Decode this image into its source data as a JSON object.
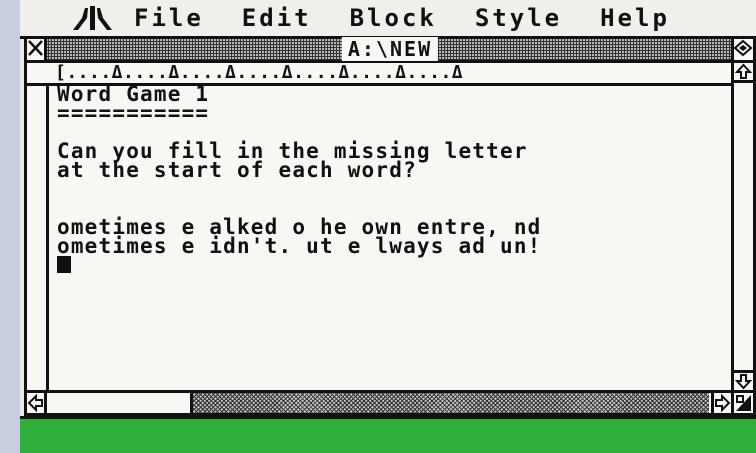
{
  "menubar": {
    "logo_icon": "atari-fuji-icon",
    "items": [
      {
        "label": "File"
      },
      {
        "label": "Edit"
      },
      {
        "label": "Block"
      },
      {
        "label": "Style"
      },
      {
        "label": "Help"
      }
    ]
  },
  "window": {
    "title": "A:\\NEW",
    "ruler": "[....Δ....Δ....Δ....Δ....Δ....Δ....Δ",
    "lines": [
      "Word Game 1",
      "===========",
      "",
      "Can you fill in the missing letter",
      "at the start of each word?",
      "",
      "",
      "ometimes e alked o he own entre, nd",
      "ometimes e idn't. ut e lways ad un!"
    ]
  },
  "colors": {
    "window_bg": "#f7f7f3",
    "desktop_green": "#2fae3a",
    "ink": "#111111"
  }
}
